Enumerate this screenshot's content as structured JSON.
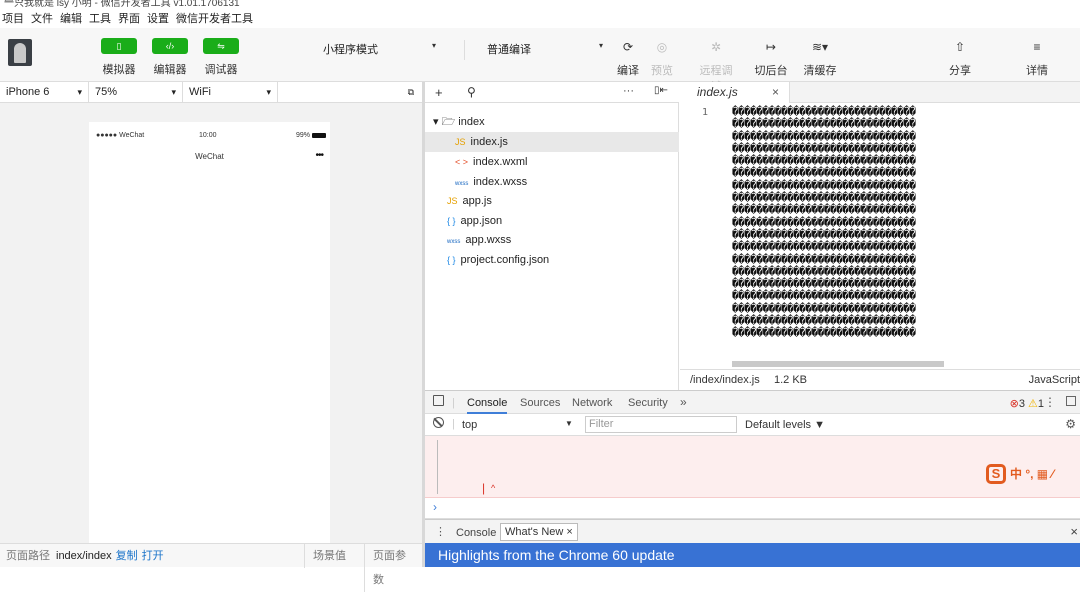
{
  "window": {
    "title": "一只我就是 lsy 小明 - 微信开发者工具 v1.01.1706131",
    "controls": "▭ ✕"
  },
  "menu": [
    "项目",
    "文件",
    "编辑",
    "工具",
    "界面",
    "设置",
    "微信开发者工具"
  ],
  "toolbar": {
    "simulator_label": "模拟器",
    "editor_label": "编辑器",
    "debugger_label": "调试器",
    "mode_select": "小程序模式",
    "compile_select": "普通编译",
    "compile_label": "编译",
    "preview_label": "预览",
    "remote_debug_label": "远程调试",
    "background_label": "切后台",
    "clear_cache_label": "清缓存",
    "share_label": "分享",
    "details_label": "详情"
  },
  "simulator": {
    "device": "iPhone 6",
    "zoom": "75%",
    "network": "WiFi",
    "status_left": "●●●●● WeChat",
    "status_time": "10:00",
    "status_battery": "99%",
    "nav_title": "WeChat",
    "nav_dots": "•••",
    "footer_path_label": "页面路径",
    "footer_path_value": "index/index",
    "footer_copy": "复制",
    "footer_open": "打开",
    "footer_scene": "场景值",
    "footer_params": "页面参数"
  },
  "explorer": {
    "add": "+",
    "search": "⚲",
    "more": "···",
    "collapse": "▯⇤",
    "folder": "index",
    "files": [
      {
        "icon": "JS",
        "name": "index.js",
        "selected": true
      },
      {
        "icon": "< >",
        "name": "index.wxml"
      },
      {
        "icon": "wxss",
        "name": "index.wxss"
      },
      {
        "icon": "JS",
        "name": "app.js"
      },
      {
        "icon": "{ }",
        "name": "app.json"
      },
      {
        "icon": "wxss",
        "name": "app.wxss"
      },
      {
        "icon": "{ }",
        "name": "project.config.json"
      }
    ]
  },
  "editor": {
    "tab": "index.js",
    "tab_close": "×",
    "line_number": "1",
    "garbled_line": "������������������������������",
    "line_count": 19,
    "status_path": "/index/index.js",
    "status_size": "1.2 KB",
    "status_lang": "JavaScript"
  },
  "devtools": {
    "tabs": [
      "Console",
      "Sources",
      "Network",
      "Security"
    ],
    "more": "»",
    "errors": "3",
    "warnings": "1",
    "context": "top",
    "filter_placeholder": "Filter",
    "levels": "Default levels ▼",
    "error_pipe": "|",
    "error_hat": "^",
    "ime": "中 °, ▦ ⁄",
    "ime_logo": "S",
    "prompt": "›",
    "drawer_console": "Console",
    "drawer_whatsnew": "What's New ×",
    "drawer_close": "×",
    "highlights": "Highlights from the Chrome 60 update"
  }
}
